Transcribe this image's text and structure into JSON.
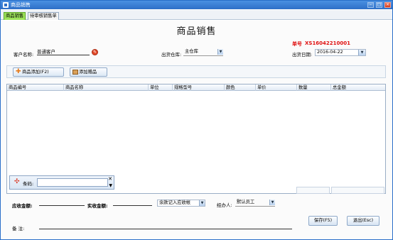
{
  "window": {
    "title": "商品销售"
  },
  "tabs": [
    {
      "label": "商品销售"
    },
    {
      "label": "待审核销售单"
    }
  ],
  "page": {
    "title": "商品销售"
  },
  "order": {
    "label": "单号",
    "number": "XS16042210001"
  },
  "customer": {
    "label": "客户名称:",
    "value": "普通客户"
  },
  "warehouse": {
    "label": "出货仓库:",
    "value": "主仓库"
  },
  "date": {
    "label": "出货日期:",
    "value": "2016-04-22"
  },
  "toolbar": {
    "add_goods": "商品添加(F2)",
    "add_gift": "添加赠品"
  },
  "grid": {
    "columns": [
      "商品编号",
      "商品名称",
      "单位",
      "规格型号",
      "颜色",
      "单价",
      "数量",
      "总金额"
    ]
  },
  "barcode": {
    "label": "条码:"
  },
  "footer": {
    "receivable_label": "应收金额:",
    "received_label": "实收金额:",
    "remainder_select": "余款记入应收帐",
    "handler_label": "经办人:",
    "handler_value": "默认员工",
    "remark_label": "备    注:",
    "save_label": "保存(F5)",
    "exit_label": "退出(Esc)"
  },
  "colors": {
    "title_bar": "#2e6fc7",
    "active_tab": "#9ee35a",
    "order_no": "#e01010"
  },
  "icons": [
    "app-icon",
    "minimize-icon",
    "maximize-icon",
    "close-icon",
    "customer-picker-icon",
    "add-icon",
    "gift-icon",
    "barcode-icon",
    "clear-icon",
    "chevron-down-icon"
  ]
}
